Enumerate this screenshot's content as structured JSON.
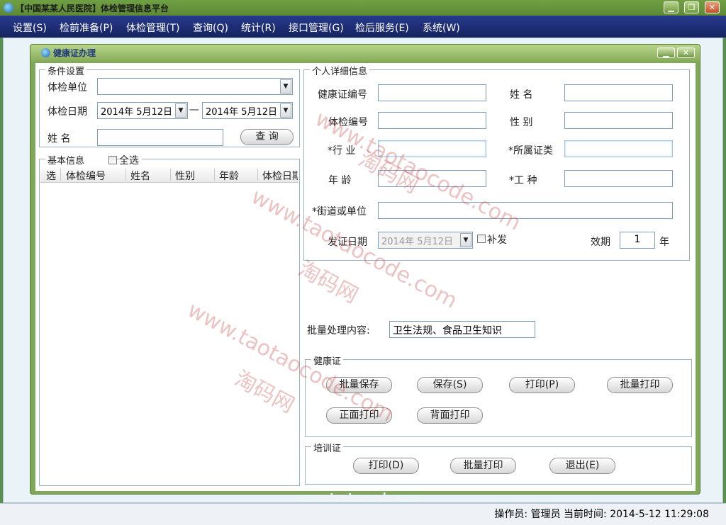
{
  "app": {
    "title": "【中国某某人民医院】体检管理信息平台",
    "buttons": {
      "minimize": "▁",
      "restore": "❐",
      "close": "✕"
    }
  },
  "menu": [
    "设置(S)",
    "检前准备(P)",
    "体检管理(T)",
    "查询(Q)",
    "统计(R)",
    "接口管理(G)",
    "检后服务(E)",
    "系统(W)"
  ],
  "dialog": {
    "title": "健康证办理",
    "conditions": {
      "group_label": "条件设置",
      "unit_label": "体检单位",
      "unit_value": "",
      "date_label": "体检日期",
      "date_from": "2014年  5月12日",
      "date_sep": "—",
      "date_to": "2014年  5月12日",
      "name_label": "姓    名",
      "name_value": "",
      "query_button": "查 询"
    },
    "basic": {
      "group_label": "基本信息",
      "select_all": "全选",
      "columns": [
        "选",
        "体检编号",
        "姓名",
        "性别",
        "年龄",
        "体检日期"
      ],
      "rows": []
    },
    "personal": {
      "group_label": "个人详细信息",
      "cert_no_label": "健康证编号",
      "name_label": "姓    名",
      "exam_no_label": "体检编号",
      "gender_label": "性    别",
      "industry_label": "*行    业",
      "cert_type_label": "*所属证类",
      "age_label": "年    龄",
      "work_type_label": "*工    种",
      "street_label": "*街道或单位",
      "issue_date_label": "发证日期",
      "issue_date_value": "2014年  5月12日",
      "reissue_label": "补发",
      "validity_label": "效期",
      "validity_value": "1",
      "validity_unit": "年"
    },
    "batch": {
      "label": "批量处理内容:",
      "value": "卫生法规、食品卫生知识"
    },
    "health_cert": {
      "group_label": "健康证",
      "batch_save": "批量保存",
      "save": "保存(S)",
      "print": "打印(P)",
      "batch_print": "批量打印",
      "front_print": "正面打印",
      "back_print": "背面打印"
    },
    "training_cert": {
      "group_label": "培训证",
      "print": "打印(D)",
      "batch_print": "批量打印",
      "exit": "退出(E)"
    }
  },
  "status": {
    "text": "操作员:  管理员   当前时间:   2014-5-12 11:29:08",
    "footer_url": "www.taotaocode.com"
  },
  "watermarks": [
    "www.taotaocode.com",
    "淘码网"
  ]
}
